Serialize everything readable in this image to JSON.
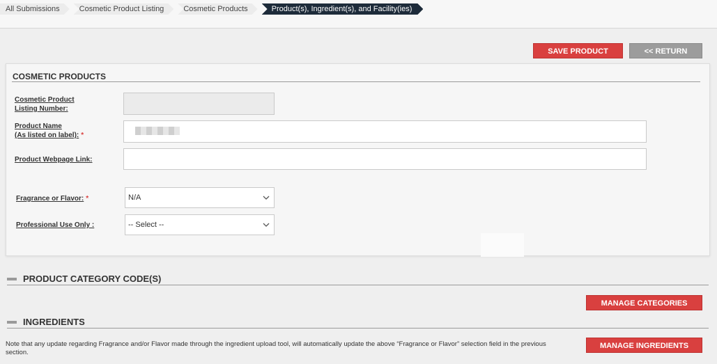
{
  "breadcrumb": [
    {
      "label": "All Submissions",
      "active": false
    },
    {
      "label": "Cosmetic Product Listing",
      "active": false
    },
    {
      "label": "Cosmetic Products",
      "active": false
    },
    {
      "label": "Product(s), Ingredient(s), and Facility(ies)",
      "active": true
    }
  ],
  "toolbar": {
    "save_label": "SAVE PRODUCT",
    "return_label": "<< RETURN"
  },
  "cosmetic_products": {
    "title": "COSMETIC PRODUCTS",
    "listing_number": {
      "label_line1": "Cosmetic Product",
      "label_line2": "Listing Number:",
      "value": ""
    },
    "product_name": {
      "label_line1": "Product Name",
      "label_line2": "(As listed on label):",
      "required": "*",
      "value": ""
    },
    "webpage_link": {
      "label": "Product Webpage Link:",
      "value": ""
    },
    "fragrance": {
      "label": "Fragrance or Flavor:",
      "required": "*",
      "selected": "N/A"
    },
    "professional_use": {
      "label": "Professional Use Only :",
      "selected": "-- Select --"
    }
  },
  "product_category": {
    "title": "PRODUCT CATEGORY CODE(S)",
    "manage_label": "MANAGE CATEGORIES"
  },
  "ingredients": {
    "title": "INGREDIENTS",
    "manage_label": "MANAGE INGREDIENTS",
    "note": "Note that any update regarding Fragrance and/or Flavor made through the ingredient upload tool, will automatically update the above “Fragrance or Flavor” selection field in the previous section."
  },
  "colors": {
    "accent_red": "#d9403f",
    "breadcrumb_active": "#1d2b3a",
    "return_gray": "#9c9c9c"
  }
}
